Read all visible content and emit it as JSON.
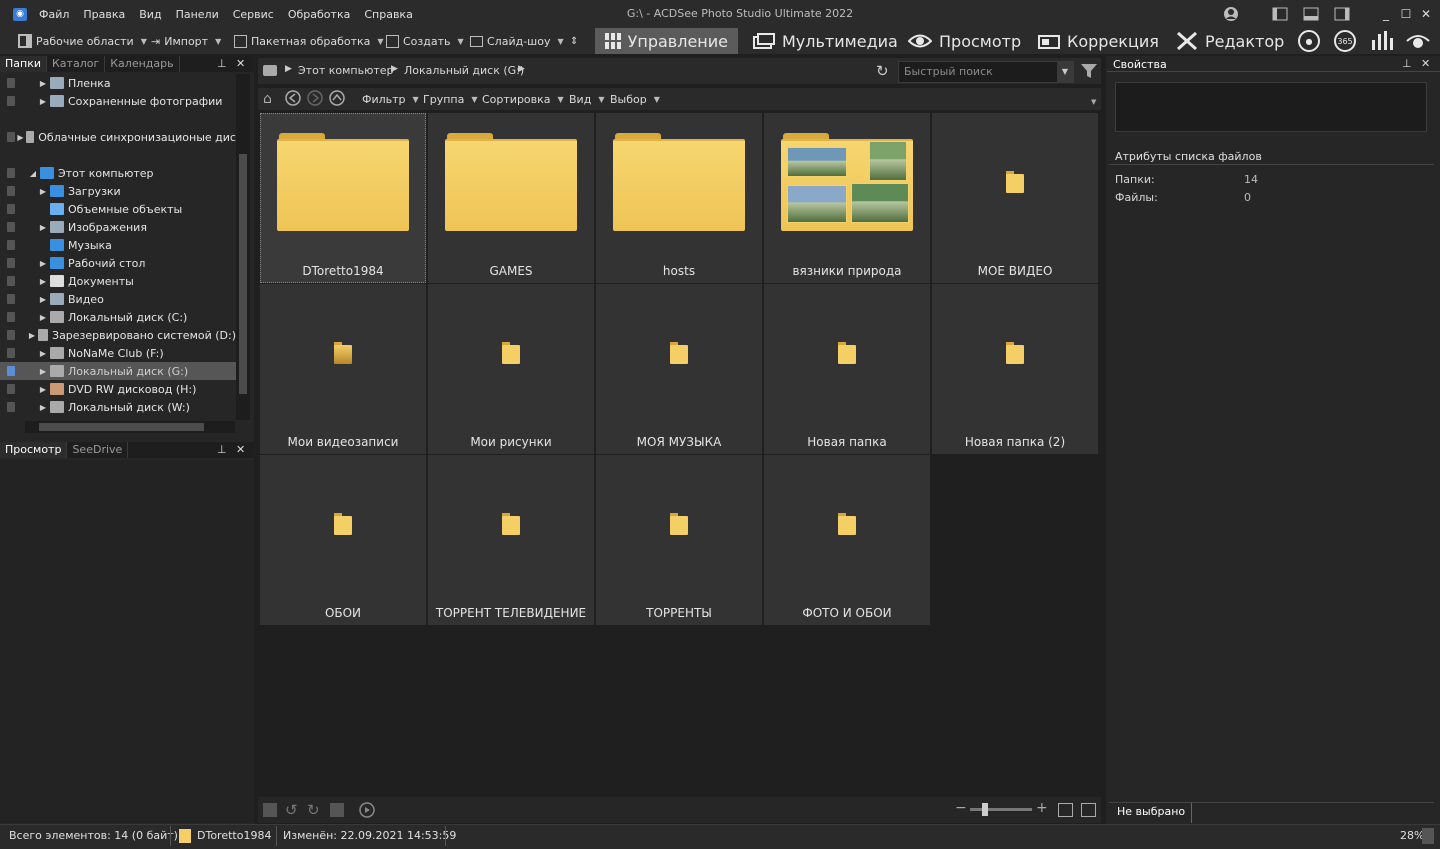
{
  "window": {
    "title": "G:\\ - ACDSee Photo Studio Ultimate 2022",
    "menu": [
      "Файл",
      "Правка",
      "Вид",
      "Панели",
      "Сервис",
      "Обработка",
      "Справка"
    ]
  },
  "toolbar": {
    "workspaces": "Рабочие области",
    "import": "Импорт",
    "batch": "Пакетная обработка",
    "create": "Создать",
    "slideshow": "Слайд-шоу",
    "modes": [
      "Управление",
      "Мультимедиа",
      "Просмотр",
      "Коррекция",
      "Редактор"
    ],
    "badge_365": "365"
  },
  "left_panel": {
    "tabs": [
      "Папки",
      "Каталог",
      "Календарь"
    ],
    "tree": [
      {
        "label": "Пленка",
        "indent": 1
      },
      {
        "label": "Сохраненные фотографии",
        "indent": 1
      },
      {
        "label": "Облачные синхронизационые дис",
        "indent": 0
      },
      {
        "label": "Этот компьютер",
        "indent": 0
      },
      {
        "label": "Загрузки",
        "indent": 1
      },
      {
        "label": "Объемные объекты",
        "indent": 1
      },
      {
        "label": "Изображения",
        "indent": 1
      },
      {
        "label": "Музыка",
        "indent": 1
      },
      {
        "label": "Рабочий стол",
        "indent": 1
      },
      {
        "label": "Документы",
        "indent": 1
      },
      {
        "label": "Видео",
        "indent": 1
      },
      {
        "label": "Локальный диск (C:)",
        "indent": 1
      },
      {
        "label": "Зарезервировано системой (D:)",
        "indent": 1
      },
      {
        "label": "NoNaMe Club (F:)",
        "indent": 1
      },
      {
        "label": "Локальный диск (G:)",
        "indent": 1
      },
      {
        "label": "DVD RW дисковод (H:)",
        "indent": 1
      },
      {
        "label": "Локальный диск (W:)",
        "indent": 1
      }
    ],
    "preview_tabs": [
      "Просмотр",
      "SeeDrive"
    ]
  },
  "address": {
    "crumbs": [
      "Этот компьютер",
      "Локальный диск (G:)"
    ],
    "search_placeholder": "Быстрый поиск"
  },
  "filterbar": [
    "Фильтр",
    "Группа",
    "Сортировка",
    "Вид",
    "Выбор"
  ],
  "items": [
    "DToretto1984",
    "GAMES",
    "hosts",
    "вязники природа",
    "МОЕ ВИДЕО",
    "Мои видеозаписи",
    "Мои рисунки",
    "МОЯ МУЗЫКА",
    "Новая папка",
    "Новая папка (2)",
    "ОБОИ",
    "ТОРРЕНТ ТЕЛЕВИДЕНИЕ",
    "ТОРРЕНТЫ",
    "ФОТО И ОБОИ"
  ],
  "right_panel": {
    "title": "Свойства",
    "section": "Атрибуты списка файлов",
    "folders_label": "Папки:",
    "folders_value": "14",
    "files_label": "Файлы:",
    "files_value": "0",
    "tab": "Не выбрано"
  },
  "status": {
    "total": "Всего элементов: 14  (0 байт)",
    "selected": "DToretto1984",
    "modified": "Изменён: 22.09.2021 14:53:59",
    "zoom": "28%"
  }
}
